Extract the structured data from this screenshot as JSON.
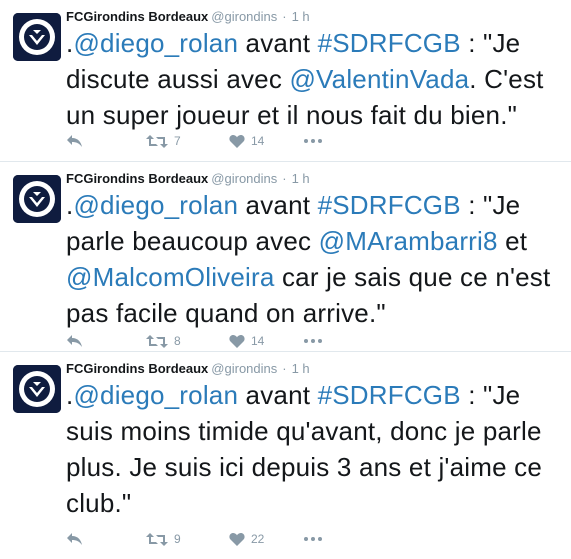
{
  "tweets": [
    {
      "name": "FCGirondins Bordeaux",
      "handle": "@girondins",
      "separator": "·",
      "time": "1 h",
      "text": {
        "p1": ".",
        "m1": "@diego_rolan",
        "p2": " avant ",
        "h1": "#SDRFCGB",
        "p3": " : \"Je discute aussi avec ",
        "m2": "@ValentinVada",
        "p4": ". C'est un super joueur et il nous fait du bien.\""
      },
      "retweets": "7",
      "likes": "14"
    },
    {
      "name": "FCGirondins Bordeaux",
      "handle": "@girondins",
      "separator": "·",
      "time": "1 h",
      "text": {
        "p1": ".",
        "m1": "@diego_rolan",
        "p2": " avant ",
        "h1": "#SDRFCGB",
        "p3": " : \"Je parle beaucoup avec ",
        "m2": "@MArambarri8",
        "p4": " et ",
        "m3": "@MalcomOliveira",
        "p5": " car je sais que ce n'est pas facile quand on arrive.\""
      },
      "retweets": "8",
      "likes": "14"
    },
    {
      "name": "FCGirondins Bordeaux",
      "handle": "@girondins",
      "separator": "·",
      "time": "1 h",
      "text": {
        "p1": ".",
        "m1": "@diego_rolan",
        "p2": " avant ",
        "h1": "#SDRFCGB",
        "p3": " : \"Je suis moins timide qu'avant, donc je parle plus. Je suis ici depuis 3 ans et j'aime ce club.\""
      },
      "retweets": "9",
      "likes": "22"
    }
  ],
  "colors": {
    "link": "#2b7bb9",
    "muted": "#8899a6",
    "text": "#14171a",
    "avatar_bg": "#0f1c3f",
    "separator": "#e1e8ed"
  },
  "icons": {
    "avatar": "girondins-crest",
    "reply": "reply-icon",
    "retweet": "retweet-icon",
    "like": "heart-icon",
    "more": "more-dots-icon"
  }
}
